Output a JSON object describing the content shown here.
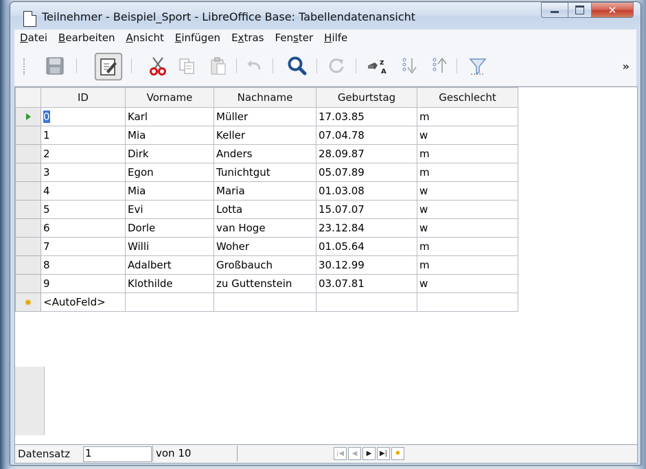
{
  "window": {
    "title": "Teilnehmer - Beispiel_Sport - LibreOffice Base: Tabellendatenansicht",
    "controls": [
      "minimize",
      "maximize",
      "close"
    ]
  },
  "menu": {
    "items": [
      {
        "pre": "",
        "ul": "D",
        "post": "atei"
      },
      {
        "pre": "",
        "ul": "B",
        "post": "earbeiten"
      },
      {
        "pre": "",
        "ul": "A",
        "post": "nsicht"
      },
      {
        "pre": "",
        "ul": "E",
        "post": "infügen"
      },
      {
        "pre": "E",
        "ul": "x",
        "post": "tras"
      },
      {
        "pre": "Fen",
        "ul": "s",
        "post": "ter"
      },
      {
        "pre": "",
        "ul": "H",
        "post": "ilfe"
      }
    ]
  },
  "toolbar": {
    "buttons": [
      "save-icon",
      "edit-icon",
      "cut-icon",
      "copy-icon",
      "paste-icon",
      "undo-icon",
      "find-icon",
      "refresh-icon",
      "sort-icon",
      "sort-ascending-icon",
      "sort-descending-icon",
      "autofilter-icon"
    ],
    "overflow": "»"
  },
  "grid": {
    "columns": [
      "ID",
      "Vorname",
      "Nachname",
      "Geburtstag",
      "Geschlecht"
    ],
    "rows": [
      [
        "0",
        "Karl",
        "Müller",
        "17.03.85",
        "m"
      ],
      [
        "1",
        "Mia",
        "Keller",
        "07.04.78",
        "w"
      ],
      [
        "2",
        "Dirk",
        "Anders",
        "28.09.87",
        "m"
      ],
      [
        "3",
        "Egon",
        "Tunichtgut",
        "05.07.89",
        "m"
      ],
      [
        "4",
        "Mia",
        "Maria",
        "01.03.08",
        "w"
      ],
      [
        "5",
        "Evi",
        "Lotta",
        "15.07.07",
        "w"
      ],
      [
        "6",
        "Dorle",
        "van Hoge",
        "23.12.84",
        "w"
      ],
      [
        "7",
        "Willi",
        "Woher",
        "01.05.64",
        "m"
      ],
      [
        "8",
        "Adalbert",
        "Großbauch",
        "30.12.99",
        "m"
      ],
      [
        "9",
        "Klothilde",
        "zu Guttenstein",
        "03.07.81",
        "w"
      ]
    ],
    "new_row": [
      "<AutoFeld>",
      "",
      "",
      "",
      ""
    ],
    "current_row": 0
  },
  "status": {
    "label": "Datensatz",
    "record": "1",
    "of_text": "von 10",
    "nav_icons": [
      "first-record-icon",
      "previous-record-icon",
      "next-record-icon",
      "last-record-icon",
      "new-record-icon"
    ]
  },
  "colors": {
    "selection": "#3875d7",
    "current_arrow": "#2f9b2f",
    "new_record_star": "#e4a900"
  }
}
